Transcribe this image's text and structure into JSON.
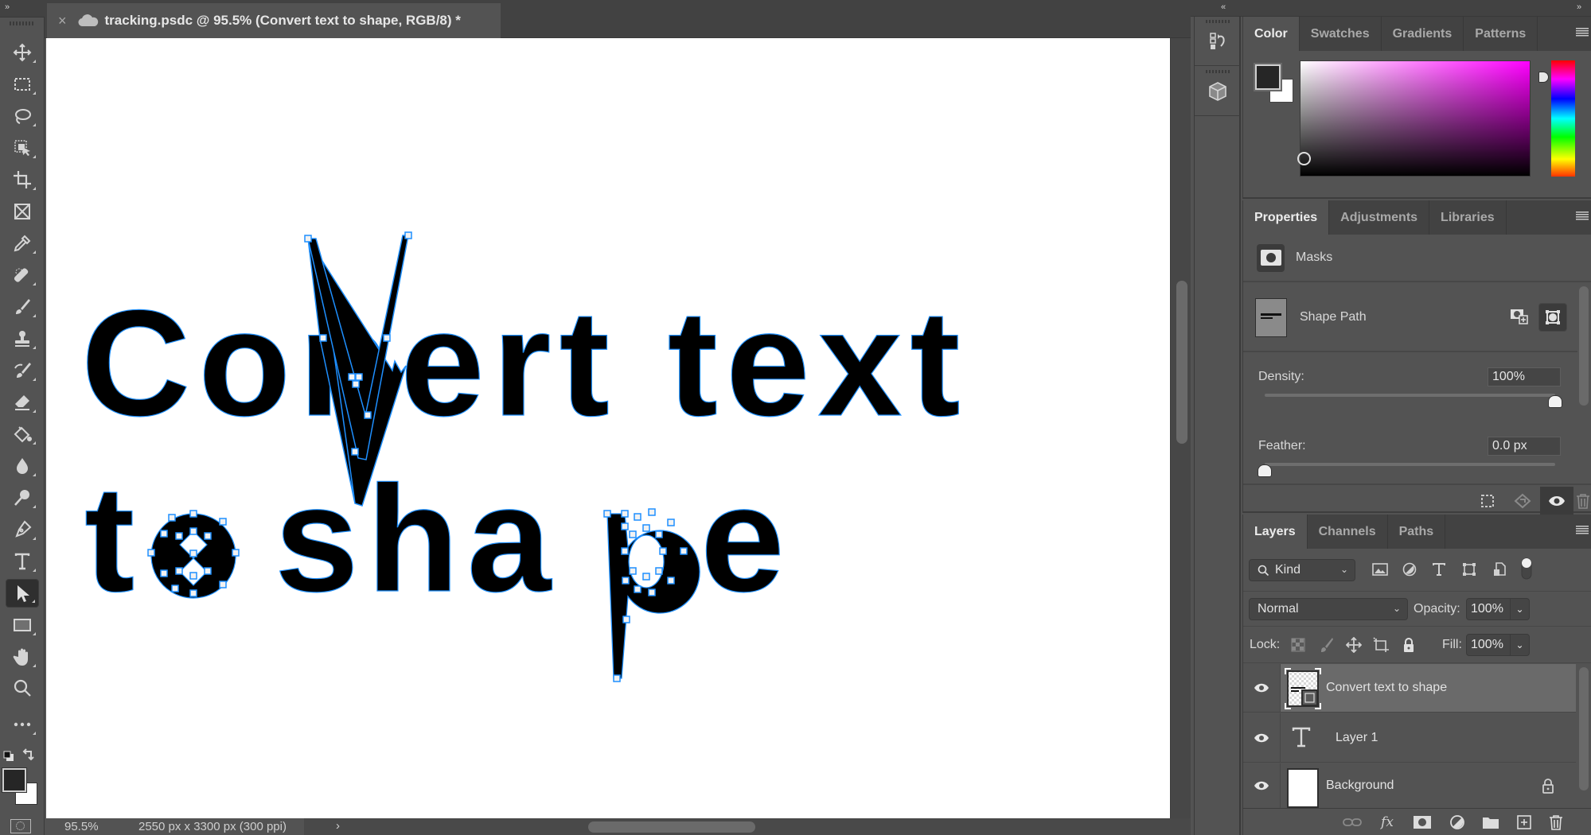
{
  "app": {
    "toolbar_collapse_label": "»",
    "panels_collapse_left_label": "«",
    "panels_collapse_right_label": "»"
  },
  "document_tab": {
    "close_label": "×",
    "title": "tracking.psdc @ 95.5% (Convert text to shape, RGB/8) *",
    "cloud_icon": "cloud-icon"
  },
  "tools": [
    {
      "name": "move-tool",
      "icon": "move-icon"
    },
    {
      "name": "rectangular-marquee-tool",
      "icon": "marquee-icon"
    },
    {
      "name": "lasso-tool",
      "icon": "lasso-icon"
    },
    {
      "name": "object-selection-tool",
      "icon": "object-select-icon"
    },
    {
      "name": "crop-tool",
      "icon": "crop-icon"
    },
    {
      "name": "frame-tool",
      "icon": "frame-icon"
    },
    {
      "name": "eyedropper-tool",
      "icon": "eyedropper-icon"
    },
    {
      "name": "healing-brush-tool",
      "icon": "bandage-icon"
    },
    {
      "name": "brush-tool",
      "icon": "brush-icon"
    },
    {
      "name": "clone-stamp-tool",
      "icon": "stamp-icon"
    },
    {
      "name": "history-brush-tool",
      "icon": "history-brush-icon"
    },
    {
      "name": "eraser-tool",
      "icon": "eraser-icon"
    },
    {
      "name": "paint-bucket-tool",
      "icon": "bucket-icon"
    },
    {
      "name": "blur-tool",
      "icon": "drop-icon"
    },
    {
      "name": "dodge-tool",
      "icon": "dodge-icon"
    },
    {
      "name": "pen-tool",
      "icon": "pen-icon"
    },
    {
      "name": "type-tool",
      "icon": "type-icon"
    },
    {
      "name": "path-selection-tool",
      "icon": "arrow-icon",
      "active": true
    },
    {
      "name": "rectangle-tool",
      "icon": "rectangle-icon"
    },
    {
      "name": "hand-tool",
      "icon": "hand-icon"
    },
    {
      "name": "zoom-tool",
      "icon": "magnifier-icon"
    },
    {
      "name": "edit-toolbar",
      "icon": "more-icon"
    }
  ],
  "colors": {
    "foreground": "#262626",
    "background": "#ffffff",
    "selection_path": "#1e8fff",
    "hue_base": "#ff00ff"
  },
  "canvas": {
    "line1": "Convert text",
    "line2": "to shape"
  },
  "status": {
    "zoom": "95.5%",
    "dimensions": "2550 px x 3300 px (300 ppi)",
    "arrow": "›"
  },
  "color_panel": {
    "tabs": [
      "Color",
      "Swatches",
      "Gradients",
      "Patterns"
    ],
    "active_tab": "Color"
  },
  "properties_panel": {
    "tabs": [
      "Properties",
      "Adjustments",
      "Libraries"
    ],
    "active_tab": "Properties",
    "masks_label": "Masks",
    "shape_path_label": "Shape Path",
    "density_label": "Density:",
    "density_value": "100%",
    "density_fraction": 1.0,
    "feather_label": "Feather:",
    "feather_value": "0.0 px",
    "feather_fraction": 0.0
  },
  "layers_panel": {
    "tabs": [
      "Layers",
      "Channels",
      "Paths"
    ],
    "active_tab": "Layers",
    "filter_kind": "Kind",
    "blend_mode": "Normal",
    "opacity_label": "Opacity:",
    "opacity_value": "100%",
    "lock_label": "Lock:",
    "fill_label": "Fill:",
    "fill_value": "100%",
    "layers": [
      {
        "name": "Convert text to shape",
        "type": "shape",
        "visible": true,
        "selected": true
      },
      {
        "name": "Layer 1",
        "type": "text",
        "visible": true,
        "selected": false
      },
      {
        "name": "Background",
        "type": "pixel",
        "visible": true,
        "selected": false,
        "locked": true
      }
    ]
  }
}
